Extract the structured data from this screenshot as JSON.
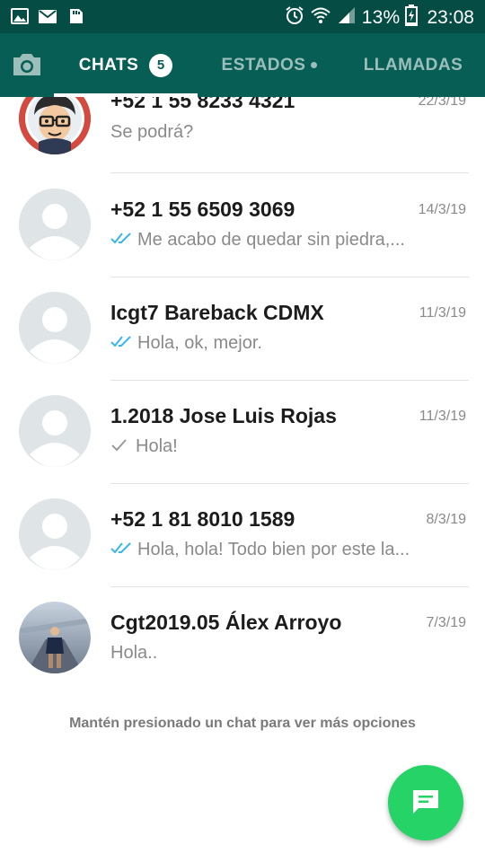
{
  "status_bar": {
    "battery": "13%",
    "time": "23:08",
    "icons": [
      "image-icon",
      "mail-icon",
      "sd-card-icon",
      "alarm-icon",
      "wifi-icon",
      "signal-icon",
      "battery-charging-icon"
    ]
  },
  "tabs": {
    "camera_icon": "camera-icon",
    "chats": {
      "label": "CHATS",
      "badge": "5"
    },
    "estados": {
      "label": "ESTADOS"
    },
    "llamadas": {
      "label": "LLAMADAS"
    }
  },
  "chats": [
    {
      "name": "+52 1 55 8233 4321",
      "date": "22/3/19",
      "preview": "Se podrá?",
      "tick": "none",
      "avatar": "cartoon"
    },
    {
      "name": "+52 1 55 6509 3069",
      "date": "14/3/19",
      "preview": "Me acabo de quedar sin piedra,...",
      "tick": "double-blue",
      "avatar": "default"
    },
    {
      "name": "Icgt7 Bareback CDMX",
      "date": "11/3/19",
      "preview": "Hola, ok, mejor.",
      "tick": "double-blue",
      "avatar": "default"
    },
    {
      "name": "1.2018 Jose Luis Rojas",
      "date": "11/3/19",
      "preview": "Hola!",
      "tick": "single-grey",
      "avatar": "default"
    },
    {
      "name": "+52 1 81 8010 1589",
      "date": "8/3/19",
      "preview": "Hola, hola! Todo bien por este la...",
      "tick": "double-blue",
      "avatar": "default"
    },
    {
      "name": "Cgt2019.05 Álex Arroyo",
      "date": "7/3/19",
      "preview": "Hola..",
      "tick": "none",
      "avatar": "photo"
    }
  ],
  "footer_hint": "Mantén presionado un chat para ver más opciones",
  "fab": {
    "icon": "new-chat-icon"
  },
  "colors": {
    "status_bar": "#054D44",
    "toolbar": "#075E54",
    "fab": "#25D366",
    "read_tick": "#34B7F1"
  }
}
